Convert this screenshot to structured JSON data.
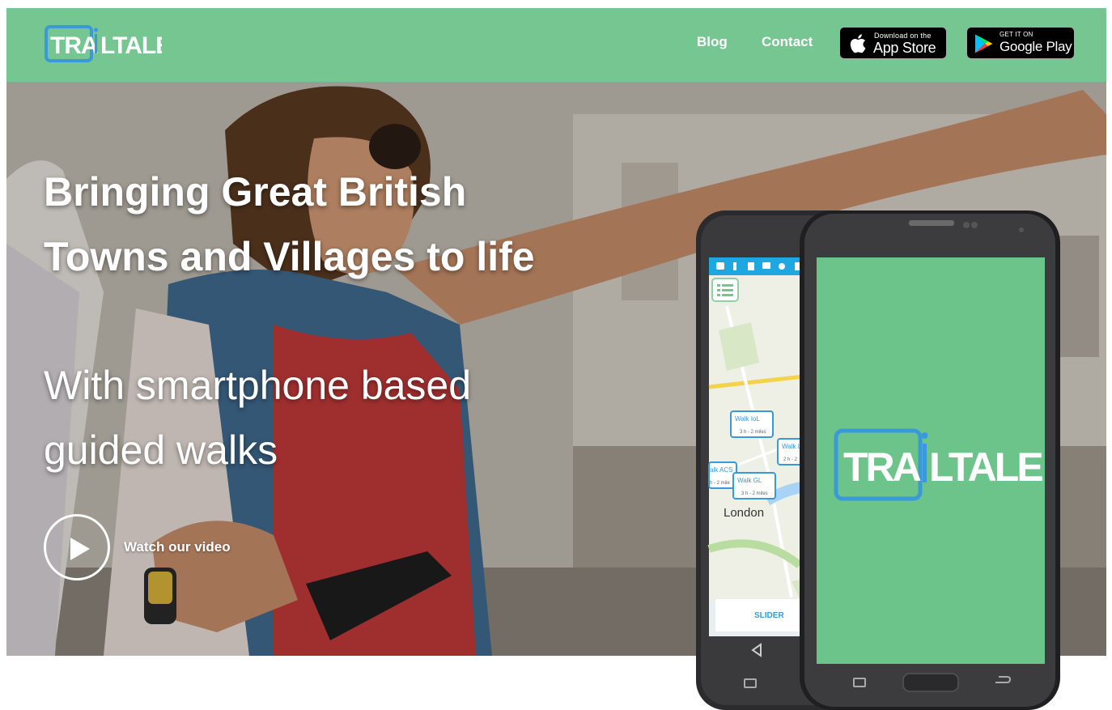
{
  "brand": {
    "name": "TRAILTALE",
    "primary_color": "#75c690",
    "accent_blue": "#3a9ad9"
  },
  "header": {
    "nav": [
      {
        "label": "Blog"
      },
      {
        "label": "Contact"
      }
    ],
    "app_store": {
      "small": "Download on the",
      "big": "App Store",
      "icon": "apple-icon"
    },
    "google_play": {
      "small": "GET IT ON",
      "big": "Google Play",
      "icon": "google-play-icon"
    }
  },
  "hero": {
    "title": "Bringing Great British Towns and Villages to life",
    "subtitle": "With smartphone based guided walks",
    "video_label": "Watch our video",
    "play_icon": "play-icon"
  },
  "phone_map": {
    "city_label": "London",
    "slider_label": "SLIDER",
    "walks": [
      {
        "name": "Walk IoL",
        "detail": "3 h - 2 miles"
      },
      {
        "name": "Walk L",
        "detail": "2 h - 2"
      },
      {
        "name": "alk ACS",
        "detail": "h - 2 mile"
      },
      {
        "name": "Walk GL",
        "detail": "3 h - 2 miles"
      }
    ]
  }
}
